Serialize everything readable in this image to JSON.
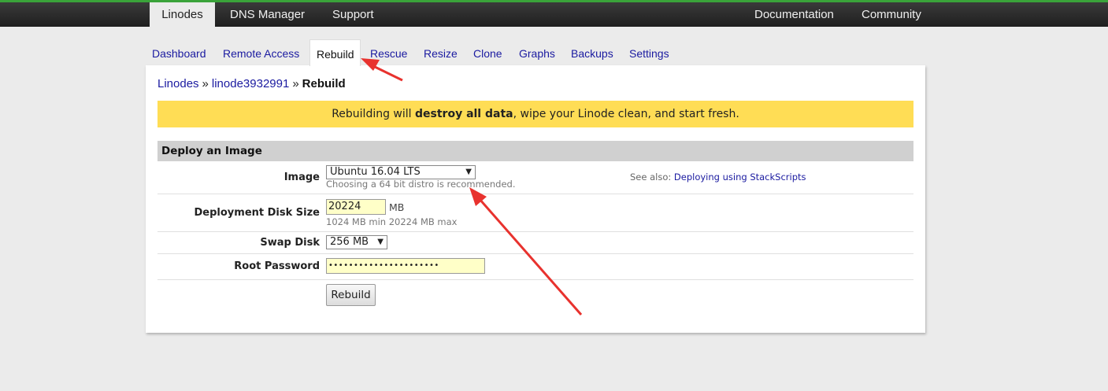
{
  "topnav": {
    "left": [
      "Linodes",
      "DNS Manager",
      "Support"
    ],
    "right": [
      "Documentation",
      "Community"
    ],
    "active": "Linodes"
  },
  "subtabs": [
    "Dashboard",
    "Remote Access",
    "Rebuild",
    "Rescue",
    "Resize",
    "Clone",
    "Graphs",
    "Backups",
    "Settings"
  ],
  "active_subtab": "Rebuild",
  "breadcrumb": {
    "root": "Linodes",
    "node": "linode3932991",
    "sep": "»",
    "current": "Rebuild"
  },
  "warning": {
    "pre": "Rebuilding will ",
    "bold": "destroy all data",
    "post": ", wipe your Linode clean, and start fresh."
  },
  "section_title": "Deploy an Image",
  "form": {
    "image_label": "Image",
    "image_value": "Ubuntu 16.04 LTS",
    "image_hint": "Choosing a 64 bit distro is recommended.",
    "see_also_prefix": "See also:",
    "see_also_link": "Deploying using StackScripts",
    "disk_label": "Deployment Disk Size",
    "disk_value": "20224",
    "disk_unit": "MB",
    "disk_hint": "1024 MB min 20224 MB max",
    "swap_label": "Swap Disk",
    "swap_value": "256 MB",
    "password_label": "Root Password",
    "password_value": "••••••••••••••••••••••",
    "submit_label": "Rebuild"
  },
  "colors": {
    "accent_green": "#3aa33a",
    "warning_bg": "#ffdd55",
    "link": "#1a1aa0",
    "annotation_red": "#e8322e"
  },
  "icons": {
    "dropdown": "chevron-down-icon",
    "annotation": "red-arrow-annotation"
  }
}
